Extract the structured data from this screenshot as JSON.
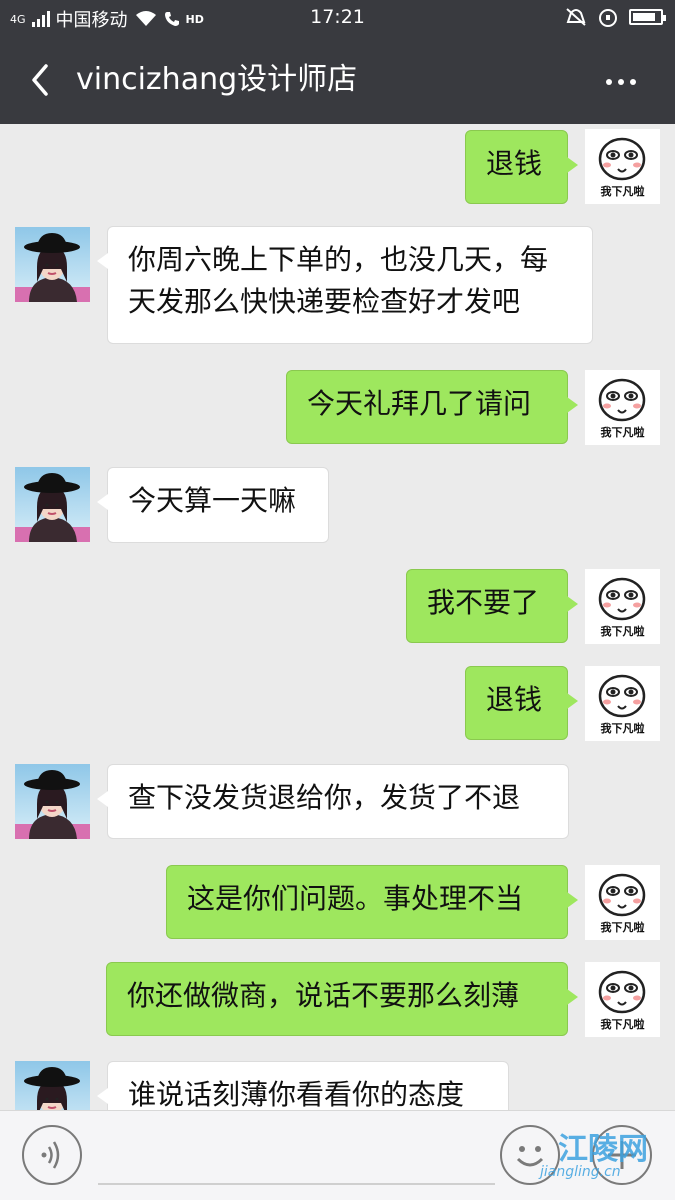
{
  "status_bar": {
    "network": "4G",
    "carrier": "中国移动",
    "hd_label": "HD",
    "time": "17:21",
    "battery_level": 0.85
  },
  "header": {
    "title": "vincizhang设计师店"
  },
  "me": {
    "avatar_caption": "我下凡啦"
  },
  "messages": [
    {
      "side": "sent",
      "text": "退钱"
    },
    {
      "side": "recv",
      "lines": [
        "你周六晚上下单的，也没几天，每",
        "天发那么快快递要检查好才发吧"
      ]
    },
    {
      "side": "sent",
      "text": "今天礼拜几了请问"
    },
    {
      "side": "recv",
      "text": "今天算一天嘛"
    },
    {
      "side": "sent",
      "text": "我不要了"
    },
    {
      "side": "sent",
      "text": "退钱"
    },
    {
      "side": "recv",
      "text": "查下没发货退给你，发货了不退"
    },
    {
      "side": "sent",
      "text": "这是你们问题。事处理不当"
    },
    {
      "side": "sent",
      "text": "你还做微商，说话不要那么刻薄"
    },
    {
      "side": "recv",
      "text": "谁说话刻薄你看看你的态度"
    }
  ],
  "watermark": {
    "name": "江陵网",
    "url": "jiangling.cn"
  },
  "colors": {
    "header_bg": "#393a3f",
    "sent_bubble": "#9ee75e",
    "recv_bubble": "#ffffff",
    "chat_bg": "#ebebeb"
  }
}
